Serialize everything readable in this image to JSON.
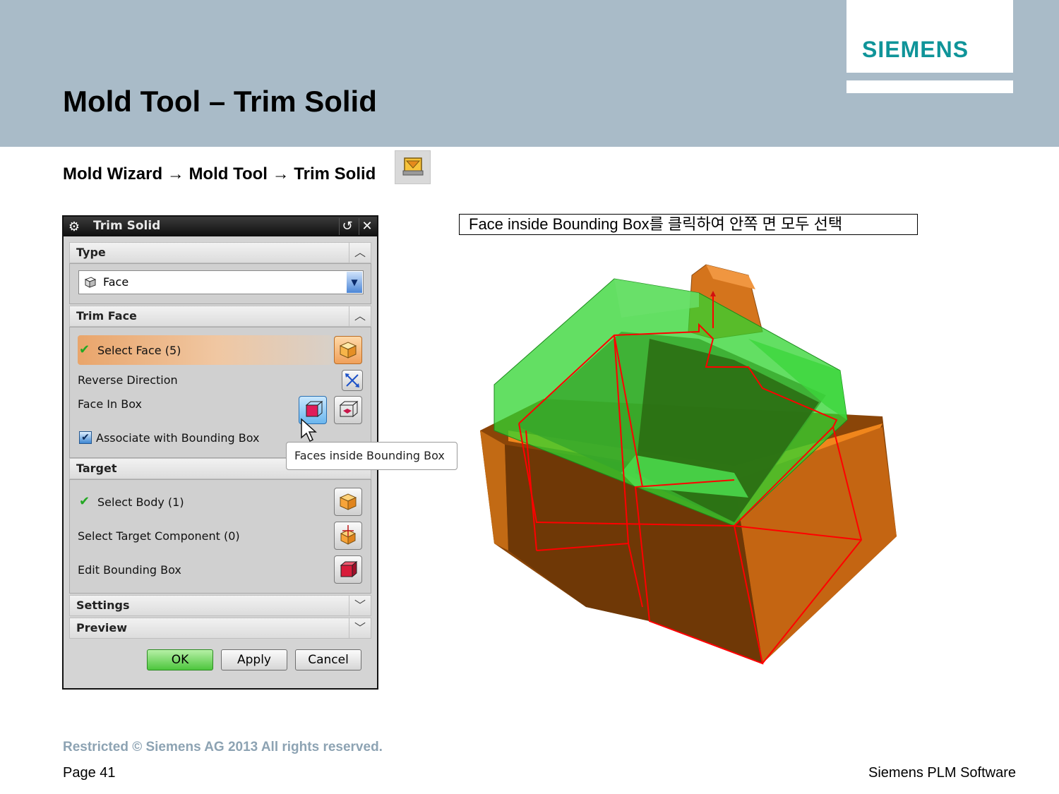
{
  "header": {
    "title": "Mold Tool – Trim Solid",
    "logo": "SIEMENS"
  },
  "breadcrumb": {
    "text": "Mold Wizard → Mold Tool → Trim Solid",
    "icon": "trim-solid-icon"
  },
  "dialog": {
    "title": "Trim Solid",
    "type_section": {
      "label": "Type",
      "value": "Face"
    },
    "trim_face_section": {
      "label": "Trim Face",
      "select_face": "Select Face (5)",
      "reverse_direction": "Reverse Direction",
      "face_in_box": "Face In Box",
      "associate": "Associate with Bounding Box",
      "associate_checked": true
    },
    "target_section": {
      "label": "Target",
      "select_body": "Select Body (1)",
      "select_target_component": "Select Target Component (0)",
      "edit_bounding_box": "Edit Bounding Box"
    },
    "settings_label": "Settings",
    "preview_label": "Preview",
    "buttons": {
      "ok": "OK",
      "apply": "Apply",
      "cancel": "Cancel"
    },
    "tooltip": "Faces inside Bounding Box"
  },
  "caption": "Face inside Bounding Box를 클릭하여 안쪽 면 모두 선택",
  "footer": {
    "restricted": "Restricted © Siemens AG 2013 All rights reserved.",
    "page": "Page 41",
    "company": "Siemens PLM Software"
  },
  "colors": {
    "header_bg": "#a9bbc8",
    "logo": "#0f9499",
    "model_orange": "#e57a10",
    "model_green": "#37d137",
    "edge_red": "#ff0000"
  }
}
